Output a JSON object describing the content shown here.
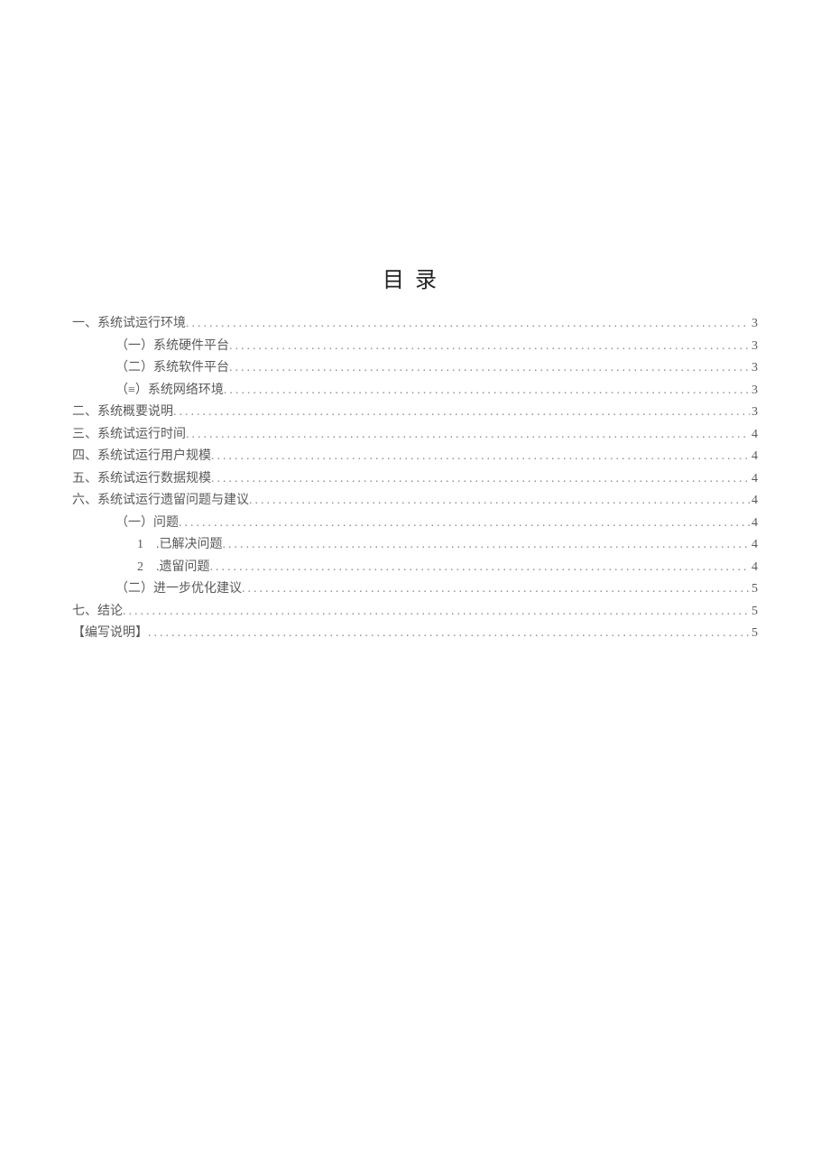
{
  "title": "目录",
  "toc": [
    {
      "label": "一、系统试运行环境",
      "page": "3",
      "indent": 0
    },
    {
      "label": "（一）系统硬件平台 ",
      "page": "3",
      "indent": 1
    },
    {
      "label": "（二）系统软件平台 ",
      "page": "3",
      "indent": 1
    },
    {
      "label": "（≡）系统网络环境 ",
      "page": "3",
      "indent": 1
    },
    {
      "label": "二、系统概要说明",
      "page": "3",
      "indent": 0
    },
    {
      "label": "三、系统试运行时间",
      "page": "4",
      "indent": 0
    },
    {
      "label": "四、系统试运行用户规模",
      "page": "4",
      "indent": 0
    },
    {
      "label": "五、系统试运行数据规模",
      "page": "4",
      "indent": 0
    },
    {
      "label": "六、系统试运行遗留问题与建议",
      "page": "4",
      "indent": 0
    },
    {
      "label": "（一）问题 ",
      "page": "4",
      "indent": 1
    },
    {
      "label": "1　.已解决问题 ",
      "page": "4",
      "indent": 2
    },
    {
      "label": "2　.遗留问题 ",
      "page": "4",
      "indent": 2
    },
    {
      "label": "（二）进一步优化建议 ",
      "page": "5",
      "indent": 1
    },
    {
      "label": "七、结论",
      "page": "5",
      "indent": 0
    },
    {
      "label": "【编写说明】",
      "page": "5",
      "indent": 0
    }
  ]
}
